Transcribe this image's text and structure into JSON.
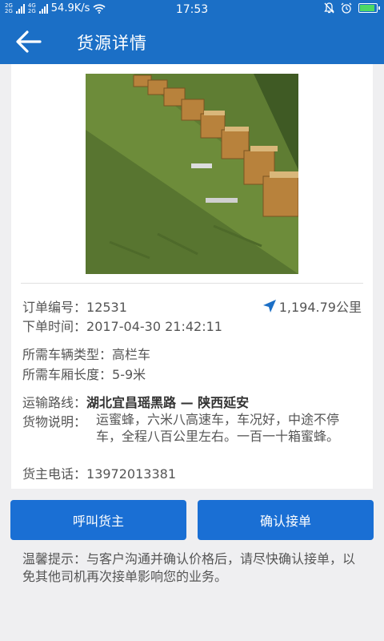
{
  "status_bar": {
    "network_top": "2G",
    "network_bottom": "2G",
    "network2_top": "4G",
    "network2_bottom": "2G",
    "speed": "54.9K/s",
    "time": "17:53"
  },
  "app_bar": {
    "title": "货源详情"
  },
  "order": {
    "number_label": "订单编号：",
    "number": "12531",
    "distance": "1,194.79公里",
    "time_label": "下单时间：",
    "time": "2017-04-30 21:42:11",
    "vehicle_type_label": "所需车辆类型：",
    "vehicle_type": "高栏车",
    "box_length_label": "所需车厢长度：",
    "box_length": "5-9米",
    "route_label": "运输路线：",
    "route": "湖北宜昌瑶黑路 — 陕西延安",
    "desc_label": "货物说明：",
    "desc": "运蜜蜂，六米八高速车，车况好，中途不停车，全程八百公里左右。一百一十箱蜜蜂。",
    "phone_label": "货主电话：",
    "phone": "13972013381"
  },
  "actions": {
    "call_label": "呼叫货主",
    "confirm_label": "确认接单"
  },
  "tip": "温馨提示：与客户沟通并确认价格后，请尽快确认接单，以免其他司机再次接单影响您的业务。",
  "colors": {
    "primary": "#1b6fc6",
    "button": "#1a6fd4",
    "background": "#efeff1"
  }
}
